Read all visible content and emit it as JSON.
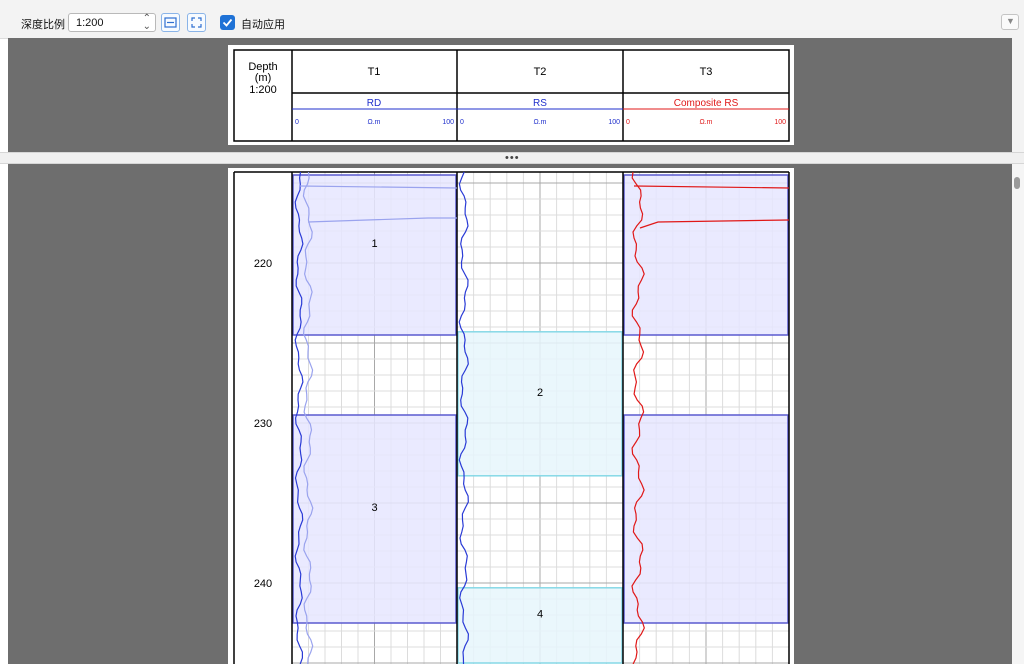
{
  "toolbar": {
    "depth_scale_label": "深度比例",
    "scale_value": "1:200",
    "fit_width_icon": "fit-width-icon",
    "fit_all_icon": "fit-all-icon",
    "auto_apply_label": "自动应用",
    "auto_apply_checked": true,
    "collapse_icon": "chevron-down-icon"
  },
  "header": {
    "depth_title": "Depth",
    "depth_unit": "(m)",
    "depth_scale": "1:200",
    "tracks": [
      {
        "title": "T1",
        "curve": "RD",
        "min": "0",
        "unit": "Ω.m",
        "max": "100",
        "color": "#1f2fcc"
      },
      {
        "title": "T2",
        "curve": "RS",
        "min": "0",
        "unit": "Ω.m",
        "max": "100",
        "color": "#1f2fcc"
      },
      {
        "title": "T3",
        "curve": "Composite RS",
        "min": "0",
        "unit": "Ω.m",
        "max": "100",
        "color": "#e01818"
      }
    ]
  },
  "splitter_label": "•••",
  "depth_ticks": [
    "220",
    "230",
    "240"
  ],
  "zones": [
    {
      "label": "1",
      "top_m": 214.5,
      "bottom_m": 224.5,
      "color": "#e6e6ff",
      "edge": "#5a5acf"
    },
    {
      "label": "2",
      "top_m": 224.3,
      "bottom_m": 233.3,
      "color": "#e6f6fb",
      "edge": "#86d8e6"
    },
    {
      "label": "3",
      "top_m": 229.5,
      "bottom_m": 242.5,
      "color": "#e6e6ff",
      "edge": "#5a5acf"
    },
    {
      "label": "4",
      "top_m": 240.3,
      "bottom_m": 245.0,
      "color": "#e6f6fb",
      "edge": "#86d8e6"
    }
  ]
}
